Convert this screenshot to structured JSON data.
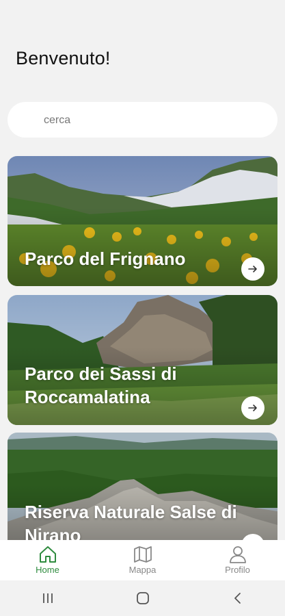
{
  "header": {
    "title": "Benvenuto!"
  },
  "search": {
    "placeholder": "cerca",
    "value": ""
  },
  "cards": [
    {
      "title": "Parco del Frignano",
      "action_icon": "arrow-right-icon"
    },
    {
      "title": "Parco dei Sassi di Roccamalatina",
      "action_icon": "arrow-right-icon"
    },
    {
      "title": "Riserva Naturale Salse di Nirano",
      "action_icon": "arrow-right-icon"
    }
  ],
  "bottom_nav": {
    "items": [
      {
        "label": "Home",
        "icon": "home-icon",
        "active": true
      },
      {
        "label": "Mappa",
        "icon": "map-icon",
        "active": false
      },
      {
        "label": "Profilo",
        "icon": "user-icon",
        "active": false
      }
    ]
  },
  "system_nav": {
    "icons": [
      "recents-icon",
      "home-circle-icon",
      "back-icon"
    ]
  },
  "colors": {
    "accent": "#2e8b3e",
    "inactive": "#888888",
    "background": "#f2f2f2"
  }
}
